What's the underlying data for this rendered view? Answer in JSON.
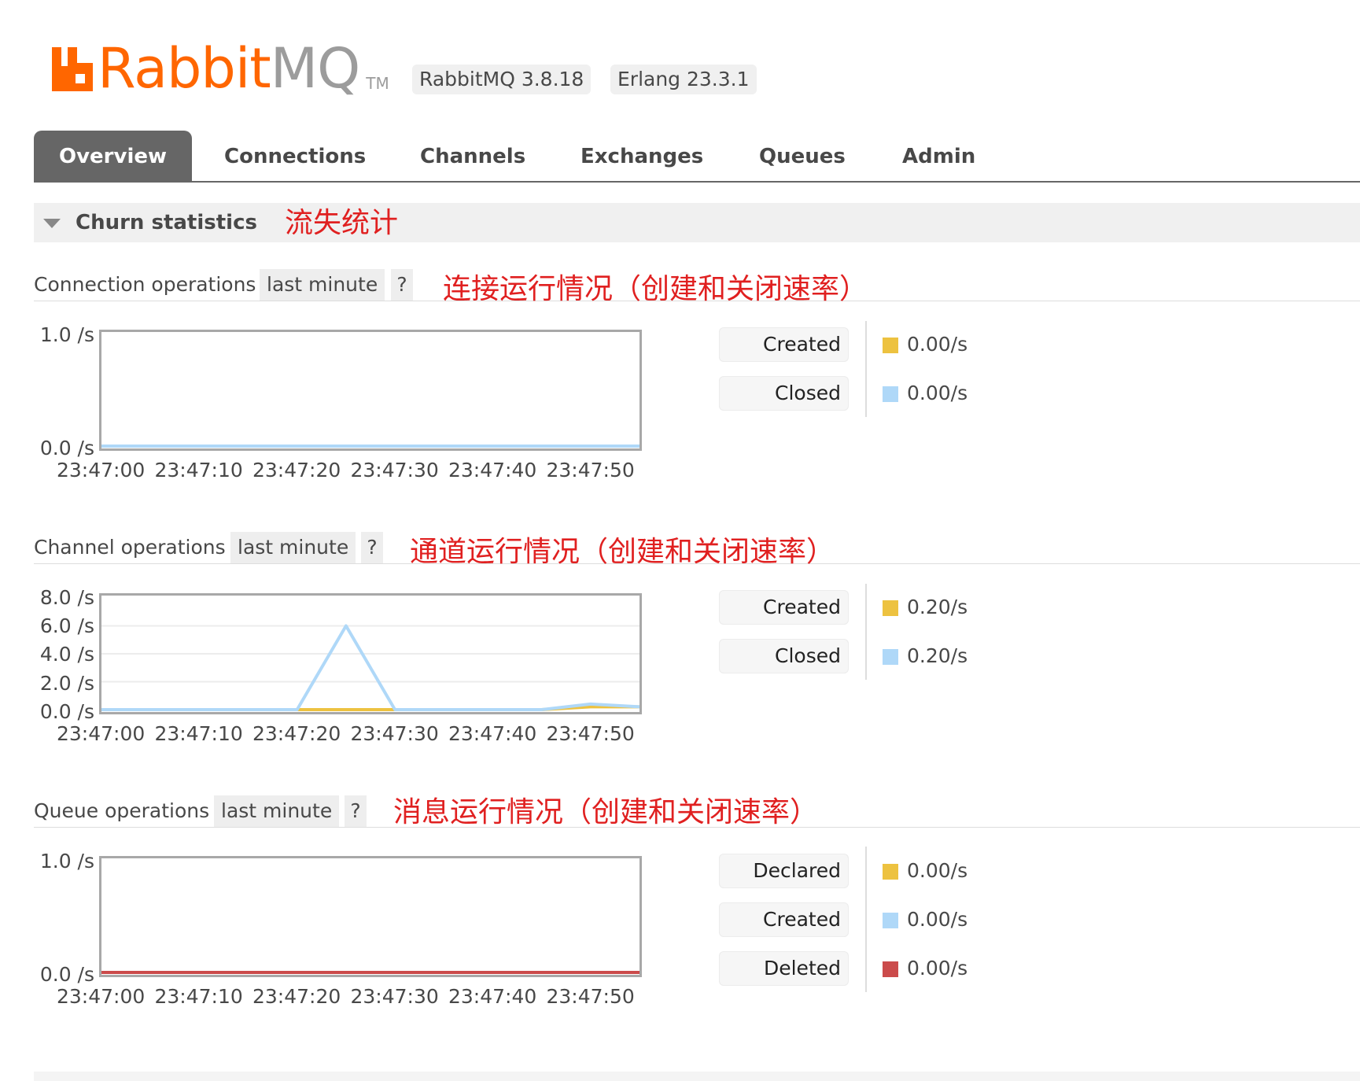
{
  "header": {
    "logo_rabbit": "Rabbit",
    "logo_mq": "MQ",
    "logo_tm": "TM",
    "version": "RabbitMQ 3.8.18",
    "erlang": "Erlang 23.3.1"
  },
  "tabs": [
    {
      "label": "Overview",
      "active": true
    },
    {
      "label": "Connections",
      "active": false
    },
    {
      "label": "Channels",
      "active": false
    },
    {
      "label": "Exchanges",
      "active": false
    },
    {
      "label": "Queues",
      "active": false
    },
    {
      "label": "Admin",
      "active": false
    }
  ],
  "section": {
    "title": "Churn statistics",
    "annotation": "流失统计"
  },
  "colors": {
    "yellow": "#edc240",
    "blue": "#afd8f8",
    "red": "#cb4b4b"
  },
  "blocks": [
    {
      "label": "Connection operations",
      "range": "last minute",
      "help": "?",
      "annotation": "连接运行情况（创建和关闭速率）",
      "legend": [
        {
          "label": "Created",
          "rate": "0.00/s",
          "color": "yellow"
        },
        {
          "label": "Closed",
          "rate": "0.00/s",
          "color": "blue"
        }
      ]
    },
    {
      "label": "Channel operations",
      "range": "last minute",
      "help": "?",
      "annotation": "通道运行情况（创建和关闭速率）",
      "legend": [
        {
          "label": "Created",
          "rate": "0.20/s",
          "color": "yellow"
        },
        {
          "label": "Closed",
          "rate": "0.20/s",
          "color": "blue"
        }
      ]
    },
    {
      "label": "Queue operations",
      "range": "last minute",
      "help": "?",
      "annotation": "消息运行情况（创建和关闭速率）",
      "legend": [
        {
          "label": "Declared",
          "rate": "0.00/s",
          "color": "yellow"
        },
        {
          "label": "Created",
          "rate": "0.00/s",
          "color": "blue"
        },
        {
          "label": "Deleted",
          "rate": "0.00/s",
          "color": "red"
        }
      ]
    }
  ],
  "chart_data": [
    {
      "type": "line",
      "x": [
        "23:47:00",
        "23:47:10",
        "23:47:20",
        "23:47:30",
        "23:47:40",
        "23:47:50"
      ],
      "xticks": [
        "23:47:00",
        "23:47:10",
        "23:47:20",
        "23:47:30",
        "23:47:40",
        "23:47:50"
      ],
      "yticks": [
        "1.0 /s",
        "0.0 /s"
      ],
      "ylim": [
        0,
        1.0
      ],
      "series": [
        {
          "name": "Created",
          "color": "#edc240",
          "values": [
            0,
            0,
            0,
            0,
            0,
            0
          ]
        },
        {
          "name": "Closed",
          "color": "#afd8f8",
          "values": [
            0,
            0,
            0,
            0,
            0,
            0
          ]
        }
      ]
    },
    {
      "type": "line",
      "x": [
        "23:47:00",
        "23:47:05",
        "23:47:10",
        "23:47:15",
        "23:47:20",
        "23:47:25",
        "23:47:30",
        "23:47:35",
        "23:47:40",
        "23:47:45",
        "23:47:50",
        "23:47:55"
      ],
      "xticks": [
        "23:47:00",
        "23:47:10",
        "23:47:20",
        "23:47:30",
        "23:47:40",
        "23:47:50"
      ],
      "yticks": [
        "8.0 /s",
        "6.0 /s",
        "4.0 /s",
        "2.0 /s",
        "0.0 /s"
      ],
      "ylim": [
        0,
        8.0
      ],
      "series": [
        {
          "name": "Created",
          "color": "#edc240",
          "values": [
            0,
            0,
            0,
            0,
            0,
            0,
            0,
            0,
            0,
            0,
            0.2,
            0.2
          ]
        },
        {
          "name": "Closed",
          "color": "#afd8f8",
          "values": [
            0,
            0,
            0,
            0,
            0,
            6.0,
            0,
            0,
            0,
            0,
            0.4,
            0.2
          ]
        }
      ]
    },
    {
      "type": "line",
      "x": [
        "23:47:00",
        "23:47:10",
        "23:47:20",
        "23:47:30",
        "23:47:40",
        "23:47:50"
      ],
      "xticks": [
        "23:47:00",
        "23:47:10",
        "23:47:20",
        "23:47:30",
        "23:47:40",
        "23:47:50"
      ],
      "yticks": [
        "1.0 /s",
        "0.0 /s"
      ],
      "ylim": [
        0,
        1.0
      ],
      "series": [
        {
          "name": "Declared",
          "color": "#edc240",
          "values": [
            0,
            0,
            0,
            0,
            0,
            0
          ]
        },
        {
          "name": "Created",
          "color": "#afd8f8",
          "values": [
            0,
            0,
            0,
            0,
            0,
            0
          ]
        },
        {
          "name": "Deleted",
          "color": "#cb4b4b",
          "values": [
            0,
            0,
            0,
            0,
            0,
            0
          ]
        }
      ]
    }
  ]
}
